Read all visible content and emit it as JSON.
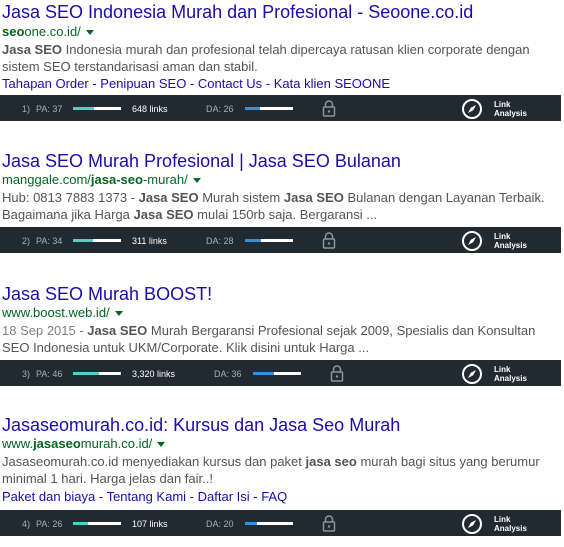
{
  "results": [
    {
      "title": "Jasa SEO Indonesia Murah dan Profesional - Seoone.co.id",
      "url_pre": "",
      "url_bold": "seo",
      "url_post": "one.co.id/",
      "date": "",
      "snippet_parts": [
        {
          "t": "Jasa ",
          "b": true
        },
        {
          "t": "SEO",
          "b": true
        },
        {
          "t": " Indonesia murah dan profesional telah dipercaya ratusan klien corporate dengan sistem SEO terstandarisasi aman dan stabil.",
          "b": false
        }
      ],
      "sitelinks": [
        "Tahapan Order",
        "Penipuan SEO",
        "Contact Us",
        "Kata klien SEOONE"
      ],
      "metrics": {
        "num": "1)",
        "pa_label": "PA: 37",
        "pa": 37,
        "links": "648 links",
        "da_label": "DA: 26",
        "da": 26,
        "la_line1": "Link",
        "la_line2": "Analysis"
      }
    },
    {
      "title": "Jasa SEO Murah Profesional | Jasa SEO Bulanan",
      "url_pre": "manggale.com/",
      "url_bold": "jasa-seo",
      "url_post": "-murah/",
      "date": "",
      "snippet_parts": [
        {
          "t": "Hub: 0813 7883 1373 - ",
          "b": false
        },
        {
          "t": "Jasa SEO",
          "b": true
        },
        {
          "t": " Murah sistem ",
          "b": false
        },
        {
          "t": "Jasa SEO",
          "b": true
        },
        {
          "t": " Bulanan dengan Layanan Terbaik. Bagaimana jika Harga ",
          "b": false
        },
        {
          "t": "Jasa SEO",
          "b": true
        },
        {
          "t": " mulai 150rb saja. Bergaransi ...",
          "b": false
        }
      ],
      "sitelinks": [],
      "metrics": {
        "num": "2)",
        "pa_label": "PA: 34",
        "pa": 34,
        "links": "311 links",
        "da_label": "DA: 28",
        "da": 28,
        "la_line1": "Link",
        "la_line2": "Analysis"
      }
    },
    {
      "title": "Jasa SEO Murah BOOST!",
      "url_pre": "www.boost.web.id/",
      "url_bold": "",
      "url_post": "",
      "date": "18 Sep 2015 - ",
      "snippet_parts": [
        {
          "t": "Jasa SEO",
          "b": true
        },
        {
          "t": " Murah Bergaransi Profesional sejak 2009, Spesialis dan Konsultan SEO Indonesia untuk UKM/Corporate. Klik disini untuk Harga ...",
          "b": false
        }
      ],
      "sitelinks": [],
      "metrics": {
        "num": "3)",
        "pa_label": "PA: 46",
        "pa": 46,
        "links": "3,320 links",
        "da_label": "DA: 36",
        "da": 36,
        "la_line1": "Link",
        "la_line2": "Analysis"
      }
    },
    {
      "title": "Jasaseomurah.co.id: Kursus dan Jasa Seo Murah",
      "url_pre": "www.",
      "url_bold": "jasaseo",
      "url_post": "murah.co.id/",
      "date": "",
      "snippet_parts": [
        {
          "t": "Jasaseomurah.co.id menyediakan kursus dan paket ",
          "b": false
        },
        {
          "t": "jasa seo",
          "b": true
        },
        {
          "t": " murah bagi situs yang berumur minimal 1 hari. Harga jelas dan fair..!",
          "b": false
        }
      ],
      "sitelinks": [
        "Paket dan biaya",
        "Tentang Kami",
        "Daftar Isi",
        "FAQ"
      ],
      "metrics": {
        "num": "4)",
        "pa_label": "PA: 26",
        "pa": 26,
        "links": "107 links",
        "da_label": "DA: 20",
        "da": 20,
        "la_line1": "Link",
        "la_line2": "Analysis"
      }
    }
  ],
  "colors": {
    "title": "#1a0dab",
    "url": "#006621",
    "snippet": "#545454",
    "bar_bg": "#202a30",
    "pa_fill": "#4fd1c5",
    "da_fill": "#3c8ddc"
  }
}
